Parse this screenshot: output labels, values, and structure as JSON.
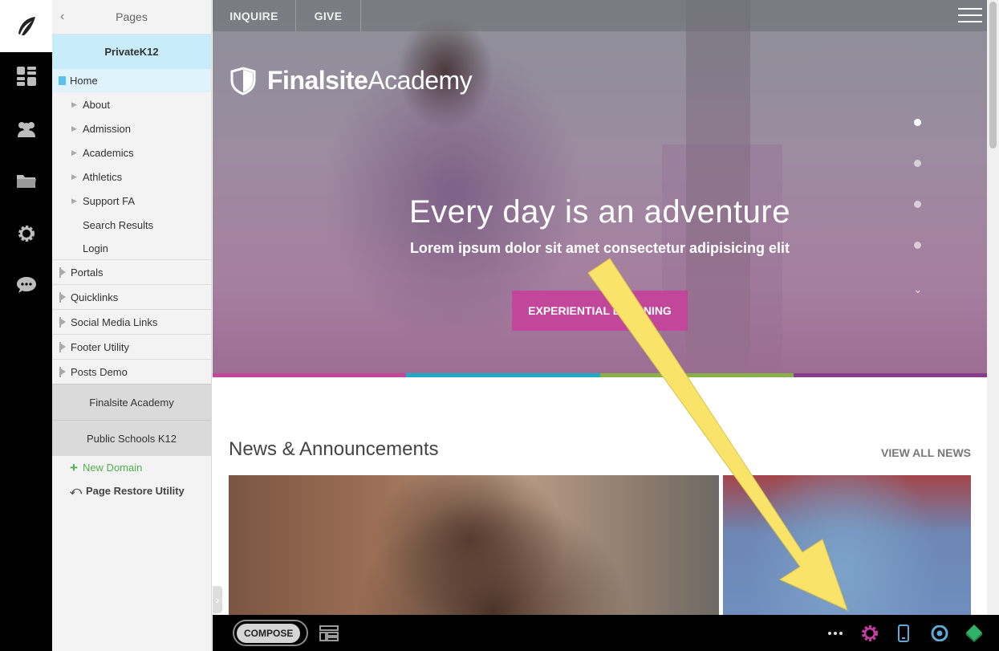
{
  "rail": {
    "icons": [
      "feather-logo-icon",
      "dashboard-icon",
      "users-icon",
      "folder-icon",
      "settings-icon",
      "chat-icon"
    ]
  },
  "pages_panel": {
    "title": "Pages",
    "domains": [
      {
        "name": "PrivateK12",
        "active": true
      },
      {
        "name": "Finalsite Academy",
        "active": false
      },
      {
        "name": "Public Schools K12",
        "active": false
      }
    ],
    "home": "Home",
    "children": [
      "About",
      "Admission",
      "Academics",
      "Athletics",
      "Support FA"
    ],
    "leaf_children": [
      "Search Results",
      "Login"
    ],
    "roots": [
      "Portals",
      "Quicklinks",
      "Social Media Links",
      "Footer Utility",
      "Posts Demo"
    ],
    "new_domain": "New Domain",
    "page_restore": "Page Restore Utility"
  },
  "site": {
    "nav": [
      "INQUIRE",
      "GIVE"
    ],
    "logo_bold": "Finalsite",
    "logo_light": "Academy",
    "hero_title": "Every day is an adventure",
    "hero_subtitle": "Lorem ipsum dolor sit amet consectetur adipisicing elit",
    "hero_button": "EXPERIENTIAL LEARNING",
    "slides": 4,
    "active_slide": 1,
    "news_title": "News & Announcements",
    "view_all": "VIEW ALL NEWS"
  },
  "bottom_bar": {
    "compose": "COMPOSE"
  },
  "colors": {
    "magenta": "#c2479a",
    "teal": "#1eaac4",
    "green": "#8ab04a",
    "purple": "#8a3a8c",
    "accent_blue_light": "#c9ecfb",
    "annotation_yellow": "#f9e368",
    "settings_icon": "#c63ea3",
    "eye_icon": "#5fa9d9",
    "publish_icon": "#2fb36b"
  }
}
